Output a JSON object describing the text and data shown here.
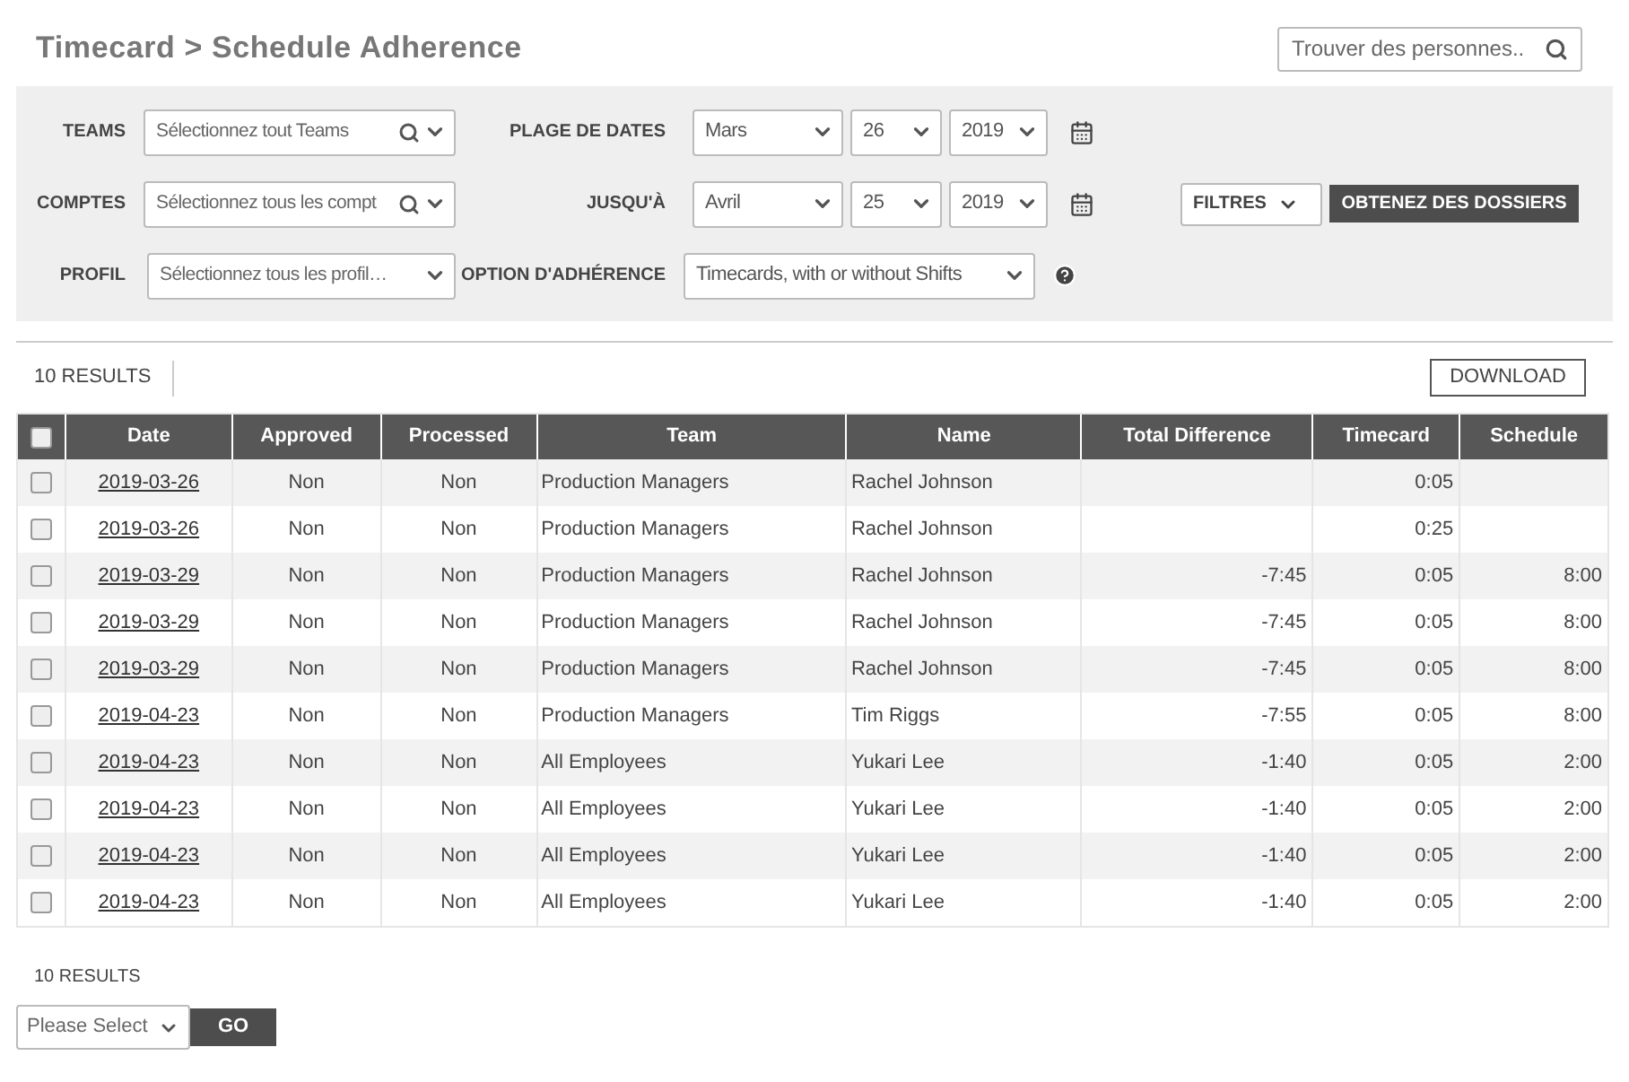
{
  "title": "Timecard > Schedule Adherence",
  "search": {
    "placeholder": "Trouver des personnes.."
  },
  "filters": {
    "teams": {
      "label": "TEAMS",
      "placeholder": "Sélectionnez tout Teams"
    },
    "accounts": {
      "label": "COMPTES",
      "placeholder": "Sélectionnez tous les compt"
    },
    "profile": {
      "label": "PROFIL",
      "placeholder": "Sélectionnez tous les profil…"
    },
    "date_range": {
      "label": "PLAGE DE DATES",
      "month": "Mars",
      "day": "26",
      "year": "2019"
    },
    "until": {
      "label": "JUSQU'À",
      "month": "Avril",
      "day": "25",
      "year": "2019"
    },
    "adherence_option": {
      "label": "OPTION D'ADHÉRENCE",
      "value": "Timecards, with or without Shifts"
    },
    "filters_button": "FILTRES",
    "get_records_button": "OBTENEZ DES DOSSIERS"
  },
  "results_count": "10 RESULTS",
  "download_button": "DOWNLOAD",
  "table": {
    "select_all_checked": false,
    "columns": [
      "Date",
      "Approved",
      "Processed",
      "Team",
      "Name",
      "Total Difference",
      "Timecard",
      "Schedule"
    ],
    "rows": [
      {
        "checked": false,
        "date": "2019-03-26",
        "approved": "Non",
        "processed": "Non",
        "team": "Production Managers",
        "name": "Rachel Johnson",
        "total_difference": "",
        "timecard": "0:05",
        "schedule": ""
      },
      {
        "checked": false,
        "date": "2019-03-26",
        "approved": "Non",
        "processed": "Non",
        "team": "Production Managers",
        "name": "Rachel Johnson",
        "total_difference": "",
        "timecard": "0:25",
        "schedule": ""
      },
      {
        "checked": false,
        "date": "2019-03-29",
        "approved": "Non",
        "processed": "Non",
        "team": "Production Managers",
        "name": "Rachel Johnson",
        "total_difference": "-7:45",
        "timecard": "0:05",
        "schedule": "8:00"
      },
      {
        "checked": false,
        "date": "2019-03-29",
        "approved": "Non",
        "processed": "Non",
        "team": "Production Managers",
        "name": "Rachel Johnson",
        "total_difference": "-7:45",
        "timecard": "0:05",
        "schedule": "8:00"
      },
      {
        "checked": false,
        "date": "2019-03-29",
        "approved": "Non",
        "processed": "Non",
        "team": "Production Managers",
        "name": "Rachel Johnson",
        "total_difference": "-7:45",
        "timecard": "0:05",
        "schedule": "8:00"
      },
      {
        "checked": false,
        "date": "2019-04-23",
        "approved": "Non",
        "processed": "Non",
        "team": "Production Managers",
        "name": "Tim Riggs",
        "total_difference": "-7:55",
        "timecard": "0:05",
        "schedule": "8:00"
      },
      {
        "checked": false,
        "date": "2019-04-23",
        "approved": "Non",
        "processed": "Non",
        "team": "All Employees",
        "name": "Yukari Lee",
        "total_difference": "-1:40",
        "timecard": "0:05",
        "schedule": "2:00"
      },
      {
        "checked": false,
        "date": "2019-04-23",
        "approved": "Non",
        "processed": "Non",
        "team": "All Employees",
        "name": "Yukari Lee",
        "total_difference": "-1:40",
        "timecard": "0:05",
        "schedule": "2:00"
      },
      {
        "checked": false,
        "date": "2019-04-23",
        "approved": "Non",
        "processed": "Non",
        "team": "All Employees",
        "name": "Yukari Lee",
        "total_difference": "-1:40",
        "timecard": "0:05",
        "schedule": "2:00"
      },
      {
        "checked": false,
        "date": "2019-04-23",
        "approved": "Non",
        "processed": "Non",
        "team": "All Employees",
        "name": "Yukari Lee",
        "total_difference": "-1:40",
        "timecard": "0:05",
        "schedule": "2:00"
      }
    ]
  },
  "footer": {
    "results_count": "10 RESULTS",
    "page_select": {
      "placeholder": "Please Select"
    },
    "go_button": "GO"
  }
}
